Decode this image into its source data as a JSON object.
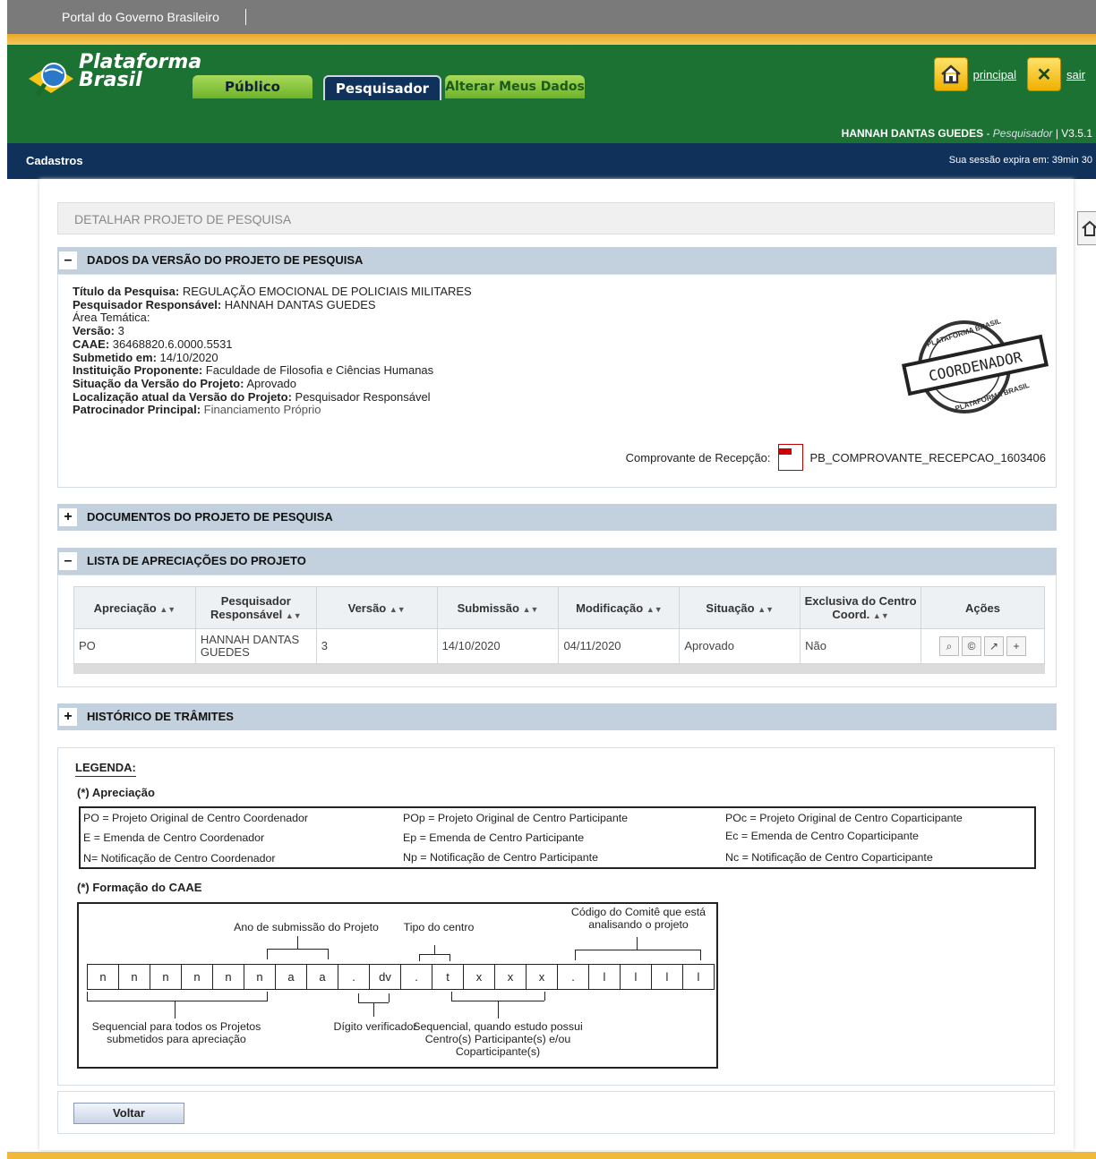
{
  "gov": {
    "label": "Portal do Governo Brasileiro"
  },
  "header": {
    "logo_line1": "Plataforma",
    "logo_line2": "Brasil",
    "nav_home": "principal",
    "nav_exit": "sair",
    "tabs": [
      "Público",
      "Pesquisador",
      "Alterar Meus Dados"
    ],
    "user_name": "HANNAH DANTAS GUEDES",
    "user_role": "Pesquisador",
    "version": "V3.5.1"
  },
  "subnav": {
    "menu": "Cadastros",
    "session": "Sua sessão expira em: 39min 30"
  },
  "page": {
    "title": "DETALHAR PROJETO DE PESQUISA"
  },
  "sections": {
    "dados": "DADOS DA VERSÃO DO PROJETO DE PESQUISA",
    "documentos": "DOCUMENTOS DO PROJETO DE PESQUISA",
    "apreciacoes": "LISTA DE APRECIAÇÕES DO PROJETO",
    "historico": "HISTÓRICO DE TRÂMITES",
    "collapse": "–",
    "expand": "+"
  },
  "info": [
    {
      "label": "Título da Pesquisa:",
      "value": "REGULAÇÃO EMOCIONAL DE POLICIAIS MILITARES",
      "bold": true
    },
    {
      "label": "Pesquisador Responsável:",
      "value": "HANNAH DANTAS GUEDES",
      "bold": true
    },
    {
      "label": "Área Temática:",
      "value": "",
      "bold": false
    },
    {
      "label": "Versão:",
      "value": "3",
      "bold": true
    },
    {
      "label": "CAAE:",
      "value": "36468820.6.0000.5531",
      "bold": true
    },
    {
      "label": "Submetido em:",
      "value": "14/10/2020",
      "bold": true
    },
    {
      "label": "Instituição Proponente:",
      "value": "Faculdade de Filosofia e Ciências Humanas",
      "bold": true
    },
    {
      "label": "Situação da Versão do Projeto:",
      "value": "Aprovado",
      "bold": true
    },
    {
      "label": "Localização atual da Versão do Projeto:",
      "value": "Pesquisador Responsável",
      "bold": true
    },
    {
      "label": "Patrocinador Principal:",
      "value": "Financiamento Próprio",
      "bold": true
    }
  ],
  "stamp": {
    "top": "PLATAFORMA BRASIL",
    "middle": "COORDENADOR",
    "bottom": "PLATAFORMA BRASIL"
  },
  "recibo": {
    "label": "Comprovante de Recepção:",
    "file": "PB_COMPROVANTE_RECEPCAO_1603406"
  },
  "table": {
    "headers": [
      "Apreciação",
      "Pesquisador Responsável",
      "Versão",
      "Submissão",
      "Modificação",
      "Situação",
      "Exclusiva do Centro Coord.",
      "Ações"
    ],
    "rows": [
      [
        "PO",
        "HANNAH DANTAS GUEDES",
        "3",
        "14/10/2020",
        "04/11/2020",
        "Aprovado",
        "Não"
      ]
    ]
  },
  "legend": {
    "title": "LEGENDA:",
    "sub1": "(*) Apreciação",
    "items": [
      "PO = Projeto Original de Centro Coordenador",
      "POp = Projeto Original de Centro Participante",
      "POc = Projeto Original de Centro Coparticipante",
      "E = Emenda de Centro Coordenador",
      "Ep = Emenda de Centro Participante",
      "Ec = Emenda de Centro Coparticipante",
      "N= Notificação de Centro Coordenador",
      "Np = Notificação de Centro Participante",
      "Nc = Notificação de Centro Coparticipante"
    ],
    "sub2": "(*) Formação do CAAE",
    "cells": [
      "n",
      "n",
      "n",
      "n",
      "n",
      "n",
      "a",
      "a",
      ".",
      "dv",
      ".",
      "t",
      "x",
      "x",
      "x",
      ".",
      "l",
      "l",
      "l",
      "l"
    ],
    "labels": {
      "ano": "Ano de submissão do Projeto",
      "tipo": "Tipo do centro",
      "comite": "Código do Comitê que está analisando o projeto",
      "seq": "Sequencial para todos os Projetos submetidos para apreciação",
      "dv": "Dígito verificador",
      "seq2": "Sequencial, quando estudo possui Centro(s) Participante(s) e/ou Coparticipante(s)"
    }
  },
  "buttons": {
    "voltar": "Voltar"
  }
}
